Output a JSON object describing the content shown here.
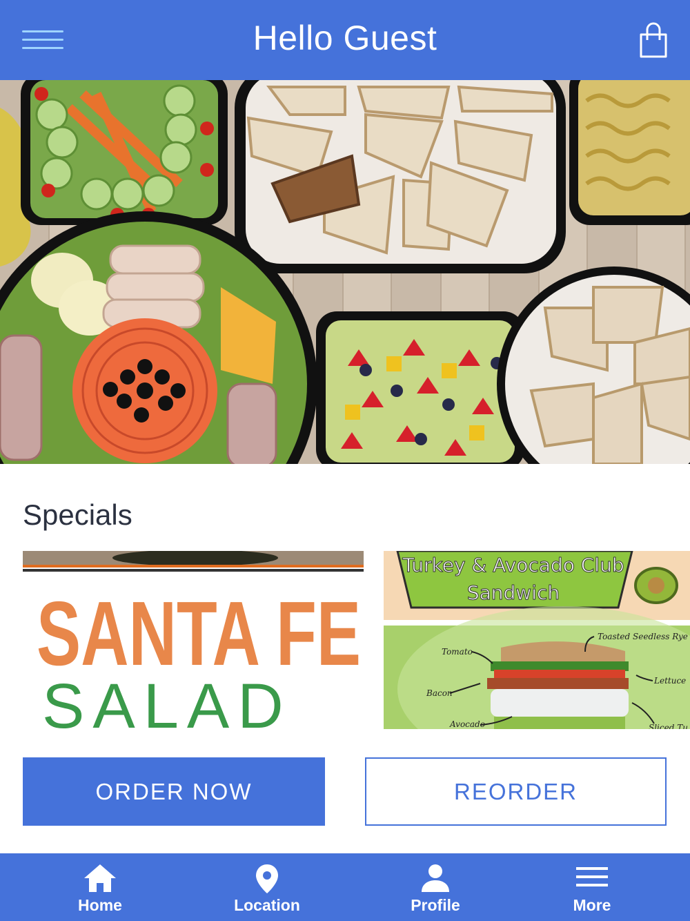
{
  "header": {
    "title": "Hello Guest"
  },
  "specials": {
    "heading": "Specials",
    "items": [
      {
        "line1": "SANTA FE",
        "line2": "SALAD"
      },
      {
        "line1": "Turkey & Avocado Club",
        "line2": "Sandwich",
        "callouts": [
          "Toasted Seedless Rye",
          "Tomato",
          "Lettuce",
          "Bacon",
          "Avocado",
          "Sliced Tu"
        ]
      }
    ]
  },
  "actions": {
    "order_now": "ORDER NOW",
    "reorder": "REORDER"
  },
  "nav": {
    "home": "Home",
    "location": "Location",
    "profile": "Profile",
    "more": "More"
  },
  "colors": {
    "brand": "#4572da",
    "menu_lines": "#9fd4ff"
  },
  "icons": {
    "menu": "hamburger-icon",
    "cart": "shopping-bag-icon",
    "home": "home-icon",
    "location": "map-pin-icon",
    "profile": "person-icon",
    "more": "hamburger-icon"
  }
}
